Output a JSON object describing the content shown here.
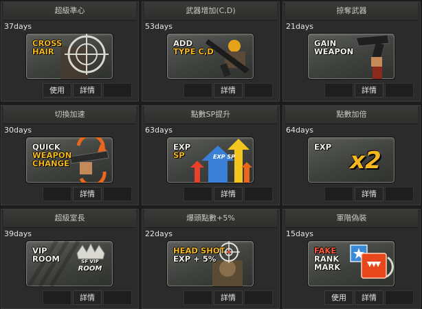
{
  "cards": [
    {
      "title": "超級準心",
      "days": "37days",
      "lines": [
        "CROSS",
        "HAIR"
      ],
      "icon": "crosshair-icon",
      "buttons": [
        "使用",
        "詳情",
        ""
      ]
    },
    {
      "title": "武器增加(C,D)",
      "days": "53days",
      "lines": [
        "ADD",
        "TYPE C,D"
      ],
      "icon": "rifle-icon",
      "buttons": [
        "",
        "詳情",
        ""
      ]
    },
    {
      "title": "掠奪武器",
      "days": "21days",
      "lines": [
        "GAIN",
        "WEAPON"
      ],
      "icon": "pistol-icon",
      "buttons": [
        "",
        "詳情",
        ""
      ]
    },
    {
      "title": "切換加速",
      "days": "30days",
      "lines": [
        "QUICK",
        "WEAPON",
        "CHANGE"
      ],
      "icon": "weapon-swap-icon",
      "buttons": [
        "",
        "詳情",
        ""
      ]
    },
    {
      "title": "點數SP提升",
      "days": "63days",
      "lines": [
        "EXP",
        "SP"
      ],
      "badge": "EXP SP",
      "icon": "exp-sp-arrows-icon",
      "buttons": [
        "",
        "詳情",
        ""
      ]
    },
    {
      "title": "點數加倍",
      "days": "64days",
      "lines": [
        "EXP"
      ],
      "badge": "x2",
      "icon": "x2-icon",
      "buttons": [
        "",
        "詳情",
        ""
      ]
    },
    {
      "title": "超級室長",
      "days": "39days",
      "lines": [
        "VIP",
        "ROOM"
      ],
      "badge_small": "SF VIP",
      "badge": "ROOM",
      "icon": "vip-crown-icon",
      "buttons": [
        "",
        "詳情",
        ""
      ]
    },
    {
      "title": "爆頭點數+5%",
      "days": "22days",
      "lines": [
        "HEAD SHOT",
        "EXP + 5%"
      ],
      "icon": "headshot-target-icon",
      "buttons": [
        "",
        "詳情",
        ""
      ]
    },
    {
      "title": "軍階偽裝",
      "days": "15days",
      "lines": [
        "FAKE",
        "RANK",
        "MARK"
      ],
      "icon": "rank-mark-icon",
      "buttons": [
        "使用",
        "詳情",
        ""
      ]
    }
  ],
  "colors": {
    "highlight_yellow": "#f3b71f",
    "highlight_red": "#ff5a3a",
    "text_white": "#f1f1ea"
  }
}
